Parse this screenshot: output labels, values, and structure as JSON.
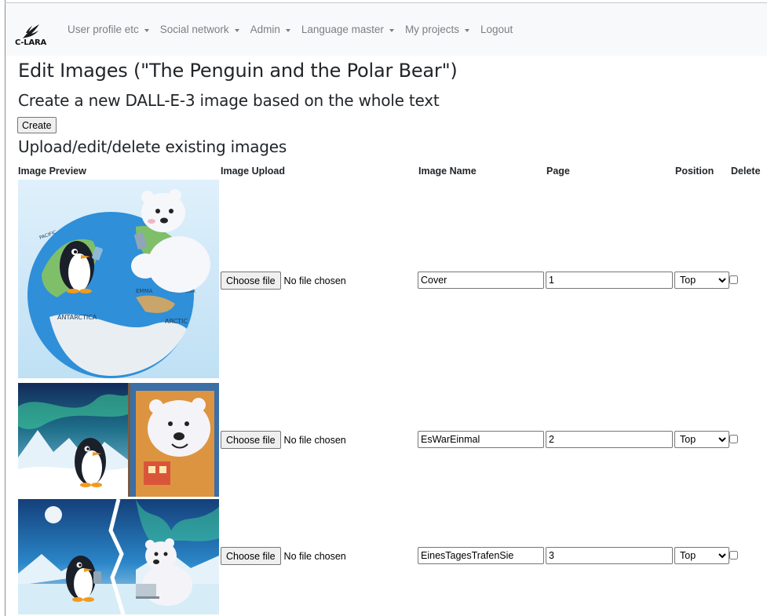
{
  "brand": {
    "logo_text": "C-LARA"
  },
  "nav": {
    "items": [
      {
        "label": "User profile etc",
        "dropdown": true
      },
      {
        "label": "Social network",
        "dropdown": true
      },
      {
        "label": "Admin",
        "dropdown": true
      },
      {
        "label": "Language master",
        "dropdown": true
      },
      {
        "label": "My projects",
        "dropdown": true
      },
      {
        "label": "Logout",
        "dropdown": false
      }
    ]
  },
  "page": {
    "title": "Edit Images (\"The Penguin and the Polar Bear\")",
    "create_heading": "Create a new DALL-E-3 image based on the whole text",
    "create_button": "Create",
    "upload_heading": "Upload/edit/delete existing images"
  },
  "table": {
    "headers": {
      "preview": "Image Preview",
      "upload": "Image Upload",
      "name": "Image Name",
      "page": "Page",
      "position": "Position",
      "delete": "Delete"
    },
    "choose_file_label": "Choose file",
    "no_file_text": "No file chosen",
    "rows": [
      {
        "name": "Cover",
        "page": "1",
        "position": "Top"
      },
      {
        "name": "EsWarEinmal",
        "page": "2",
        "position": "Top"
      },
      {
        "name": "EinesTagesTrafenSie",
        "page": "3",
        "position": "Top"
      }
    ],
    "cover_labels": {
      "antarctica": "ANTARCTICA",
      "arctic": "ARCTIC",
      "emma": "EMMA",
      "polar_bear": "POLAR BEAR"
    }
  },
  "colors": {
    "navbar_bg": "#f8f9fa",
    "nav_text": "#7b7f84",
    "ocean": "#2f8fd8",
    "land": "#7fbf6a"
  }
}
